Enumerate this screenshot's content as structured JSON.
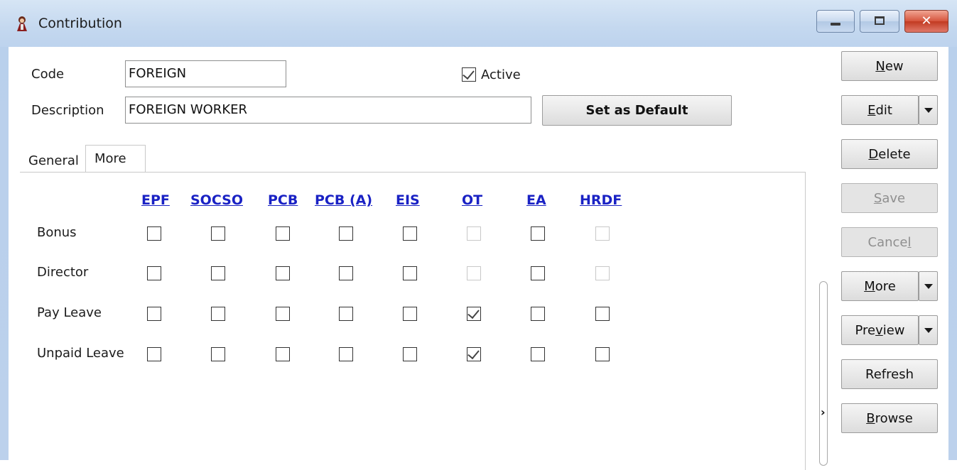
{
  "window": {
    "title": "Contribution",
    "icon": "app-doll-icon",
    "controls": {
      "minimize": "minimize-icon",
      "maximize": "maximize-icon",
      "close": "close-icon"
    }
  },
  "form": {
    "code_label": "Code",
    "code_value": "FOREIGN",
    "description_label": "Description",
    "description_value": "FOREIGN WORKER",
    "active_label": "Active",
    "active_checked": true,
    "set_default_label": "Set as Default"
  },
  "tabs": [
    {
      "label": "General",
      "active": false
    },
    {
      "label": "More",
      "active": true
    }
  ],
  "grid": {
    "columns": [
      "EPF",
      "SOCSO",
      "PCB",
      "PCB (A)",
      "EIS",
      "OT",
      "EA",
      "HRDF"
    ],
    "rows": [
      {
        "label": "Bonus",
        "checks": [
          "unchecked",
          "unchecked",
          "unchecked",
          "unchecked",
          "unchecked",
          "disabled",
          "unchecked",
          "disabled"
        ]
      },
      {
        "label": "Director",
        "checks": [
          "unchecked",
          "unchecked",
          "unchecked",
          "unchecked",
          "unchecked",
          "disabled",
          "unchecked",
          "disabled"
        ]
      },
      {
        "label": "Pay Leave",
        "checks": [
          "unchecked",
          "unchecked",
          "unchecked",
          "unchecked",
          "unchecked",
          "checked",
          "unchecked",
          "unchecked"
        ]
      },
      {
        "label": "Unpaid Leave",
        "checks": [
          "unchecked",
          "unchecked",
          "unchecked",
          "unchecked",
          "unchecked",
          "checked",
          "unchecked",
          "unchecked"
        ]
      }
    ]
  },
  "side_buttons": {
    "new": {
      "pre": "",
      "u": "N",
      "post": "ew"
    },
    "edit": {
      "pre": "",
      "u": "E",
      "post": "dit"
    },
    "delete": {
      "pre": "",
      "u": "D",
      "post": "elete"
    },
    "save": {
      "pre": "",
      "u": "S",
      "post": "ave"
    },
    "cancel": {
      "pre": "Cance",
      "u": "l",
      "post": ""
    },
    "more": {
      "pre": "",
      "u": "M",
      "post": "ore"
    },
    "preview": {
      "pre": "Pre",
      "u": "v",
      "post": "iew"
    },
    "refresh": {
      "pre": "Refresh",
      "u": "",
      "post": ""
    },
    "browse": {
      "pre": "",
      "u": "B",
      "post": "rowse"
    }
  },
  "colors": {
    "title_bg": "#c4d8ef",
    "link_blue": "#1a22c4",
    "close_red": "#c23a21"
  }
}
